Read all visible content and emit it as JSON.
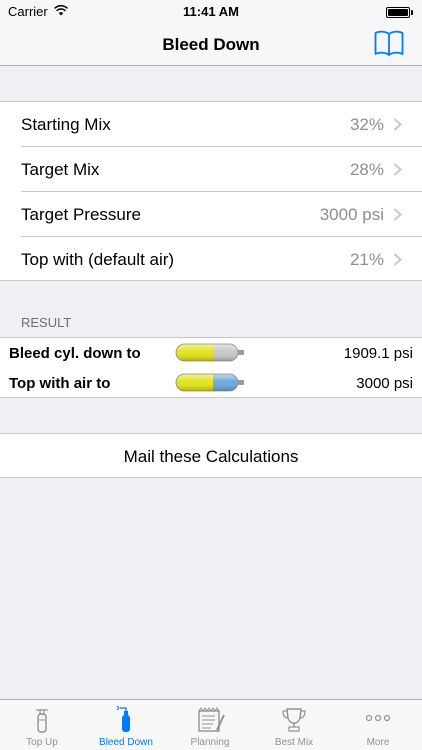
{
  "status": {
    "carrier": "Carrier",
    "time": "11:41 AM"
  },
  "nav": {
    "title": "Bleed Down",
    "book_icon": "book-icon"
  },
  "settings": [
    {
      "label": "Starting Mix",
      "value": "32%"
    },
    {
      "label": "Target Mix",
      "value": "28%"
    },
    {
      "label": "Target Pressure",
      "value": "3000 psi"
    },
    {
      "label": "Top with (default air)",
      "value": "21%"
    }
  ],
  "result": {
    "header": "RESULT",
    "rows": [
      {
        "label": "Bleed cyl. down to",
        "value": "1909.1 psi",
        "tank_fill": 0.6
      },
      {
        "label": "Top with air to",
        "value": "3000 psi",
        "tank_fill": 1.0
      }
    ]
  },
  "mail_button": "Mail these Calculations",
  "tabs": [
    {
      "label": "Top Up",
      "icon": "tank-icon",
      "active": false
    },
    {
      "label": "Bleed Down",
      "icon": "tank-bleed-icon",
      "active": true
    },
    {
      "label": "Planning",
      "icon": "notepad-icon",
      "active": false
    },
    {
      "label": "Best Mix",
      "icon": "trophy-icon",
      "active": false
    },
    {
      "label": "More",
      "icon": "more-icon",
      "active": false
    }
  ],
  "colors": {
    "accent": "#007aff",
    "tank_yellow": "#e4e31b",
    "tank_gray": "#c8c8c8",
    "tank_blue": "#6fa8dc",
    "value_gray": "#8e8e93"
  }
}
